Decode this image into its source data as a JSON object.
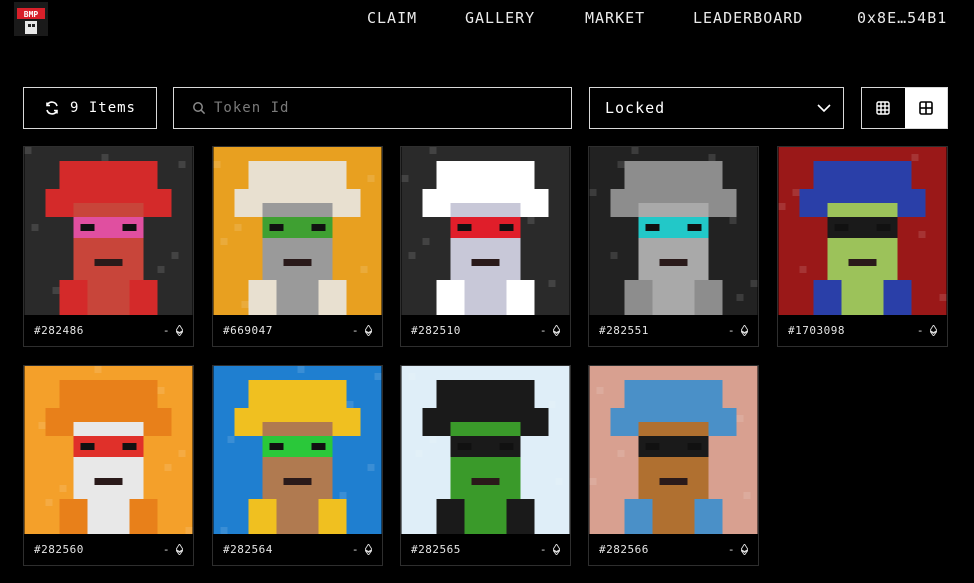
{
  "header": {
    "logo_text": "BMP",
    "nav": [
      {
        "label": "CLAIM"
      },
      {
        "label": "GALLERY"
      },
      {
        "label": "MARKET"
      },
      {
        "label": "LEADERBOARD"
      }
    ],
    "wallet": "0x8E…54B1"
  },
  "toolbar": {
    "items_label": "9 Items",
    "search_placeholder": "Token Id",
    "search_value": "",
    "filter_selected": "Locked"
  },
  "cards": [
    {
      "id": "#282486",
      "price": "-",
      "bg": "#2a2a2a",
      "skin": "#c8453a",
      "hat": "#d42a2a",
      "eyes": "#e04fa0",
      "icon": "octopus-hat-art"
    },
    {
      "id": "#669047",
      "price": "-",
      "bg": "#e8a020",
      "skin": "#9a9a9a",
      "hat": "#e8e0d0",
      "eyes": "#3fa032",
      "icon": "rainbow-robot-art"
    },
    {
      "id": "#282510",
      "price": "-",
      "bg": "#2a2a2a",
      "skin": "#c8c8d8",
      "hat": "#ffffff",
      "eyes": "#e01e2a",
      "icon": "cow-bmp-art"
    },
    {
      "id": "#282551",
      "price": "-",
      "bg": "#222222",
      "skin": "#a9a9a9",
      "hat": "#8d8d8d",
      "eyes": "#22c8c8",
      "icon": "shark-hat-art"
    },
    {
      "id": "#1703098",
      "price": "-",
      "bg": "#9a1818",
      "skin": "#9cc25a",
      "hat": "#2a3fa8",
      "eyes": "#1a1a1a",
      "icon": "wizard-art"
    },
    {
      "id": "#282560",
      "price": "-",
      "bg": "#f4a02a",
      "skin": "#e8e8e8",
      "hat": "#e8801a",
      "eyes": "#e0302a",
      "icon": "shiba-hat-art"
    },
    {
      "id": "#282564",
      "price": "-",
      "bg": "#1f7fd0",
      "skin": "#b07a50",
      "hat": "#f0c020",
      "eyes": "#2ac83a",
      "icon": "blue-flame-art"
    },
    {
      "id": "#282565",
      "price": "-",
      "bg": "#dfeef8",
      "skin": "#3a9a2a",
      "hat": "#1a1a1a",
      "eyes": "#1a1a1a",
      "icon": "green-apple-art"
    },
    {
      "id": "#282566",
      "price": "-",
      "bg": "#d8a090",
      "skin": "#b07030",
      "hat": "#4a90c8",
      "eyes": "#1a1a1a",
      "icon": "blue-hood-art"
    }
  ]
}
